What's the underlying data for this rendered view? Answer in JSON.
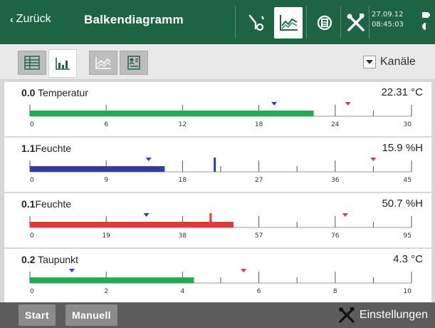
{
  "header": {
    "back_label": "Zurück",
    "title": "Balkendiagramm",
    "date": "27.09.12",
    "time": "08:45:03",
    "icons": [
      "probe-icon",
      "line-chart-icon",
      "sensor-icon",
      "tools-icon"
    ]
  },
  "toolbar": {
    "views": [
      "list-view-icon",
      "bar-view-icon",
      "line-view-icon",
      "report-view-icon"
    ],
    "active_view": 1,
    "dropdown_label": "Kanäle"
  },
  "colors": {
    "header_bg": "#1d6445",
    "green": "#22ad52",
    "blue": "#2f3fa0",
    "red": "#e63838",
    "min_marker": "#2f3fa0",
    "max_marker": "#e63838"
  },
  "chart_data": [
    {
      "type": "bar",
      "channel": "0.0",
      "name": "Temperatur",
      "value_text": "22.31 °C",
      "value": 22.31,
      "range": [
        0,
        30
      ],
      "ticks": [
        "0",
        "6",
        "12",
        "18",
        "24",
        "30"
      ],
      "color": "#22ad52",
      "min_marker": 19.2,
      "max_marker": 25.0,
      "needle": null
    },
    {
      "type": "bar",
      "channel": "1.1",
      "name": "Feuchte",
      "value_text": "15.9 %H",
      "value": 15.9,
      "range": [
        0,
        45
      ],
      "ticks": [
        "0",
        "9",
        "18",
        "27",
        "36",
        "45"
      ],
      "color": "#2f3fa0",
      "min_marker": 14.0,
      "max_marker": 40.5,
      "needle": 21.8
    },
    {
      "type": "bar",
      "channel": "0.1",
      "name": "Feuchte",
      "value_text": "50.7 %H",
      "value": 50.7,
      "range": [
        0,
        95
      ],
      "ticks": [
        "0",
        "19",
        "38",
        "57",
        "76",
        "95"
      ],
      "color": "#e63838",
      "min_marker": 29.0,
      "max_marker": 78.5,
      "needle": 45.0
    },
    {
      "type": "bar",
      "channel": "0.2",
      "name": "Taupunkt",
      "value_text": "4.3 °C",
      "value": 4.3,
      "range": [
        0,
        10
      ],
      "ticks": [
        "0",
        "2",
        "4",
        "6",
        "8",
        "10"
      ],
      "color": "#22ad52",
      "min_marker": 1.1,
      "max_marker": 5.6,
      "needle": null
    }
  ],
  "panels": [
    {
      "channel": "0.0",
      "name": " Temperatur",
      "value": "22.31 °C"
    },
    {
      "channel": "1.1",
      "name": "Feuchte",
      "value": "15.9 %H"
    },
    {
      "channel": "0.1",
      "name": "Feuchte",
      "value": "50.7 %H"
    },
    {
      "channel": "0.2",
      "name": " Taupunkt",
      "value": "4.3 °C"
    }
  ],
  "bottom": {
    "start_label": "Start",
    "manual_label": "Manuell",
    "settings_label": "Einstellungen"
  }
}
